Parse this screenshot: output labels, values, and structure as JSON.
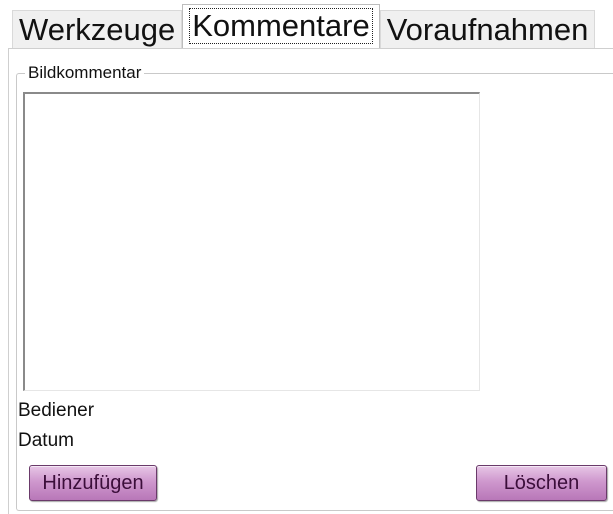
{
  "tabs": [
    {
      "label": "Werkzeuge",
      "active": false
    },
    {
      "label": "Kommentare",
      "active": true
    },
    {
      "label": "Voraufnahmen",
      "active": false
    }
  ],
  "comment_group": {
    "legend": "Bildkommentar",
    "comment_text": ""
  },
  "info": {
    "operator_label": "Bediener",
    "date_label": "Datum"
  },
  "buttons": {
    "add_label": "Hinzufügen",
    "delete_label": "Löschen"
  },
  "colors": {
    "button_fill": "#cf98ce",
    "button_border": "#6a3a6a",
    "button_text": "#3b0e3a"
  }
}
